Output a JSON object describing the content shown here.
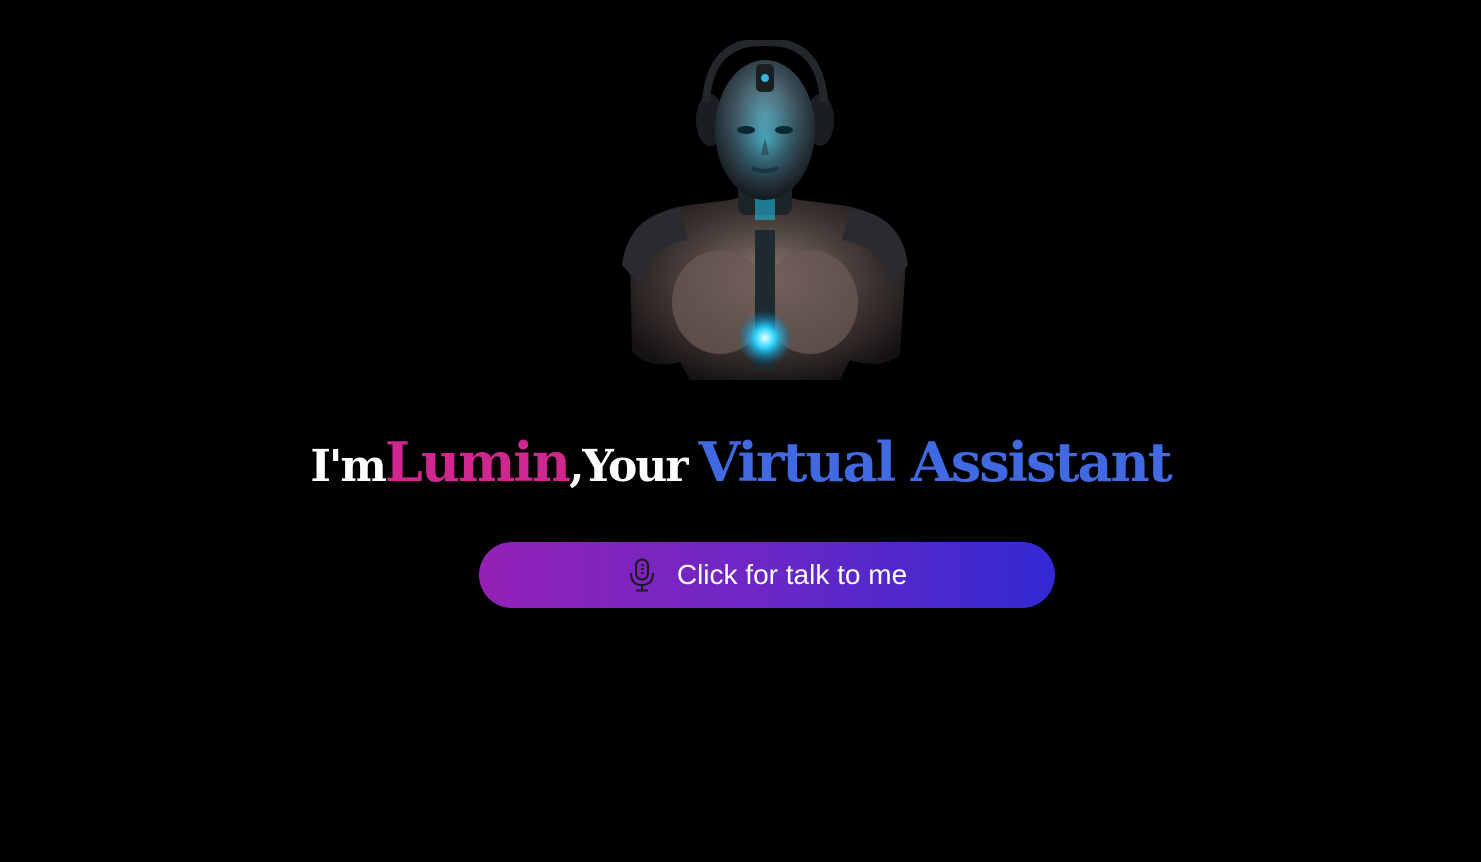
{
  "hero": {
    "image_icon": "robot-avatar-illustration"
  },
  "headline": {
    "prefix": "I'm ",
    "name": "Lumin",
    "middle": ",Your",
    "suffix": "Virtual Assistant"
  },
  "talk_button": {
    "label": "Click for talk to me",
    "icon": "microphone-icon"
  },
  "colors": {
    "background": "#000000",
    "name_accent": "#d0268f",
    "title_accent": "#4169e1",
    "button_gradient_start": "#9321b6",
    "button_gradient_end": "#3229d2"
  }
}
